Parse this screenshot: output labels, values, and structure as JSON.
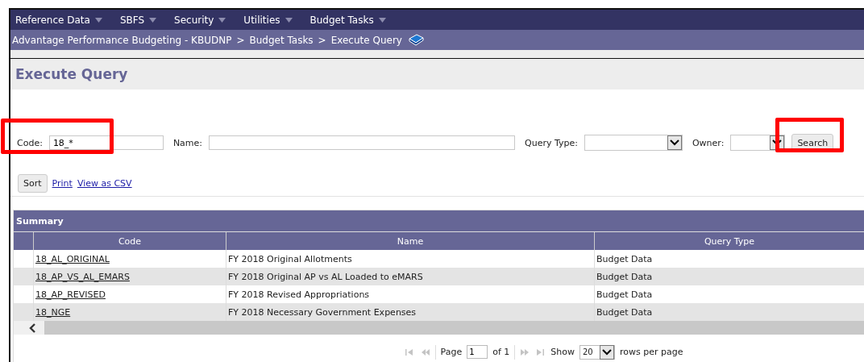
{
  "menu": [
    {
      "label": "Reference Data"
    },
    {
      "label": "SBFS"
    },
    {
      "label": "Security"
    },
    {
      "label": "Utilities"
    },
    {
      "label": "Budget Tasks"
    }
  ],
  "breadcrumb": [
    "Advantage Performance Budgeting - KBUDNP",
    "Budget Tasks",
    "Execute Query"
  ],
  "breadcrumb_separator": ">",
  "page_title": "Execute Query",
  "filters": [
    {
      "kind": "text",
      "label": "Code:",
      "value": "18_*",
      "highlighted": true
    },
    {
      "kind": "text",
      "label": "Name:",
      "highlighted": false
    },
    {
      "kind": "select",
      "label": "Query Type:",
      "highlighted": false
    },
    {
      "kind": "select",
      "label": "Owner:",
      "highlighted": false
    }
  ],
  "search_button": {
    "label": "Search",
    "highlighted": true
  },
  "actions": [
    {
      "kind": "button",
      "label": "Sort"
    },
    {
      "kind": "link",
      "label": "Print"
    },
    {
      "kind": "link",
      "label": "View as CSV"
    }
  ],
  "table": {
    "title": "Summary",
    "columns": [
      "Code",
      "Name",
      "Query Type"
    ],
    "rows": [
      [
        "18_AL_ORIGINAL",
        "FY 2018 Original Allotments",
        "Budget Data"
      ],
      [
        "18_AP_VS_AL_EMARS",
        "FY 2018 Original AP vs AL Loaded to eMARS",
        "Budget Data"
      ],
      [
        "18_AP_REVISED",
        "FY 2018 Revised Appropriations",
        "Budget Data"
      ],
      [
        "18_NGE",
        "FY 2018 Necessary Government Expenses",
        "Budget Data"
      ]
    ]
  },
  "pager": {
    "page_label": "Page",
    "page": "1",
    "of_label": "of 1",
    "show_label": "Show",
    "rows": "20",
    "rows_label": "rows per page",
    "first_disabled": true,
    "prev_disabled": true,
    "next_disabled": true,
    "last_disabled": true
  }
}
